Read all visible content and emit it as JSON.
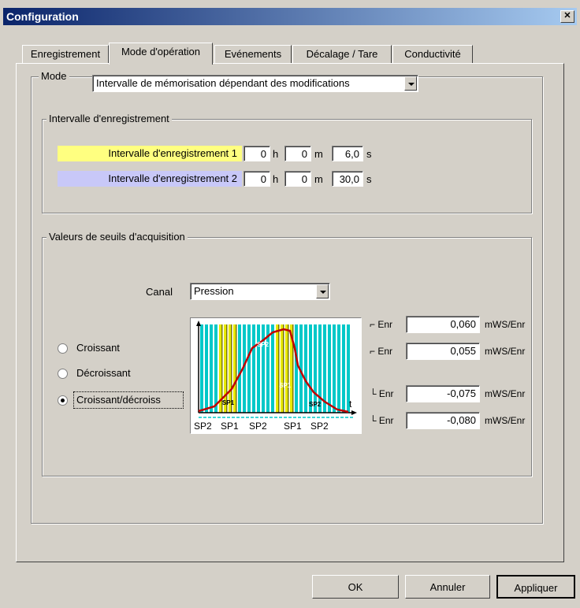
{
  "window": {
    "title": "Configuration",
    "close_label": "✕"
  },
  "tabs": [
    {
      "label": "Enregistrement"
    },
    {
      "label": "Mode d'opération"
    },
    {
      "label": "Evénements"
    },
    {
      "label": "Décalage / Tare"
    },
    {
      "label": "Conductivité"
    }
  ],
  "mode": {
    "label": "Mode",
    "value": "Intervalle de mémorisation dépendant des modifications"
  },
  "interval_group": {
    "title": "Intervalle d'enregistrement",
    "rows": [
      {
        "label": "Intervalle d'enregistrement 1",
        "color": "#ffff80",
        "h": "0",
        "m": "0",
        "s": "6,0"
      },
      {
        "label": "Intervalle d'enregistrement 2",
        "color": "#c8c8f8",
        "h": "0",
        "m": "0",
        "s": "30,0"
      }
    ],
    "unit_h": "h",
    "unit_m": "m",
    "unit_s": "s"
  },
  "threshold_group": {
    "title": "Valeurs de seuils d'acquisition",
    "canal_label": "Canal",
    "canal_value": "Pression",
    "radios": [
      {
        "label": "Croissant",
        "selected": false
      },
      {
        "label": "Décroissant",
        "selected": false
      },
      {
        "label": "Croissant/décroiss",
        "selected": true
      }
    ],
    "thresholds": [
      {
        "label": "Enr",
        "value": "0,060",
        "unit": "mWS/Enr"
      },
      {
        "label": "Enr",
        "value": "0,055",
        "unit": "mWS/Enr"
      },
      {
        "label": "Enr",
        "value": "-0,075",
        "unit": "mWS/Enr"
      },
      {
        "label": "Enr",
        "value": "-0,080",
        "unit": "mWS/Enr"
      }
    ],
    "diagram": {
      "axis_t": "t",
      "segments": [
        "SP2",
        "SP1",
        "SP2",
        "SP1",
        "SP2"
      ],
      "markers": [
        "SP1",
        "SP2",
        "SP1",
        "SP2"
      ],
      "colors": {
        "cyan": "#00c8c8",
        "yellow": "#e8e800",
        "curve": "#c00000"
      }
    }
  },
  "buttons": {
    "ok": "OK",
    "cancel": "Annuler",
    "apply": "Appliquer"
  }
}
